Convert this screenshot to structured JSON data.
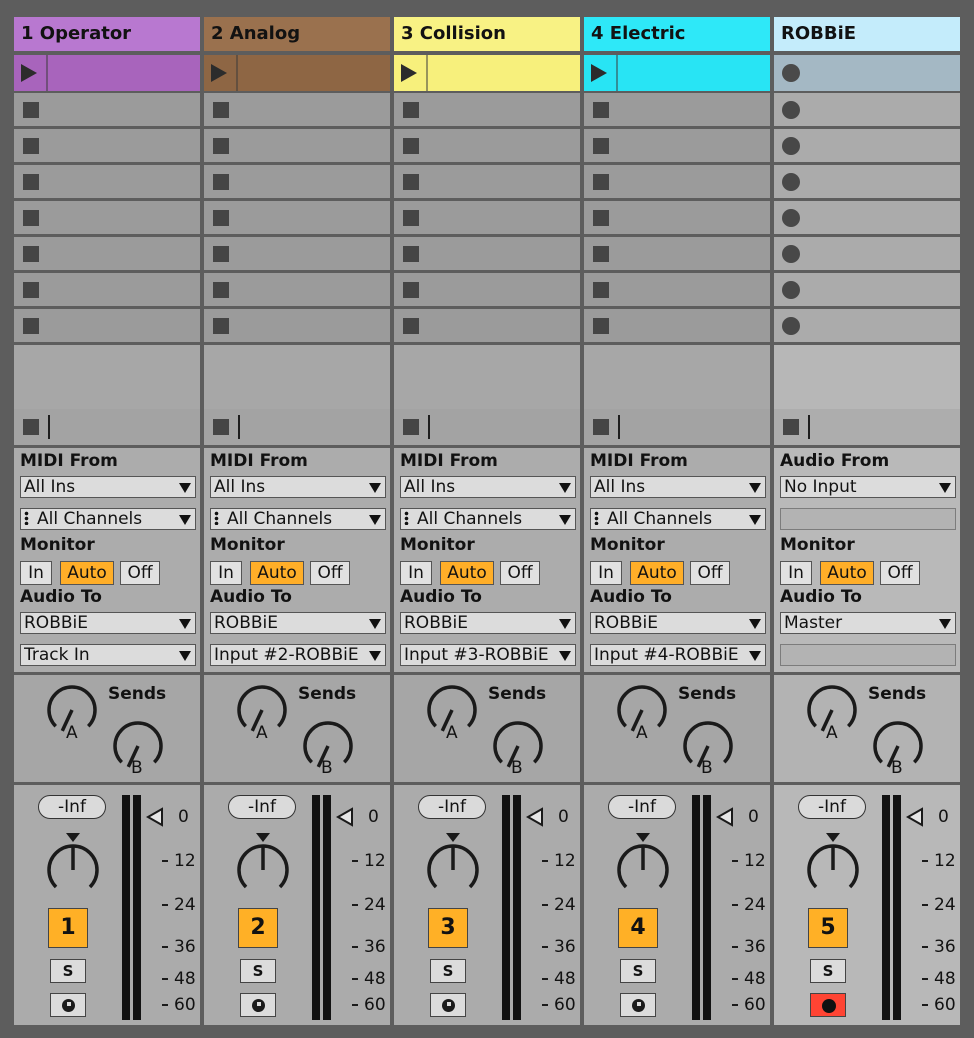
{
  "tracks": [
    {
      "name": "1 Operator",
      "color": "#b878d0",
      "ctl_color": "#a864bc",
      "type": "midi",
      "input_label": "MIDI From",
      "input": "All Ins",
      "channel": "All Channels",
      "monitor_label": "Monitor",
      "monitor": [
        "In",
        "Auto",
        "Off"
      ],
      "monitor_active": "Auto",
      "output_label": "Audio To",
      "output": "ROBBiE",
      "output_sub": "Track In",
      "sends_label": "Sends",
      "send_a": "A",
      "send_b": "B",
      "volume": "-Inf",
      "number": "1",
      "solo": "S",
      "button3": "monitor-input"
    },
    {
      "name": "2 Analog",
      "color": "#9a714e",
      "ctl_color": "#8e6644",
      "type": "midi",
      "input_label": "MIDI From",
      "input": "All Ins",
      "channel": "All Channels",
      "monitor_label": "Monitor",
      "monitor": [
        "In",
        "Auto",
        "Off"
      ],
      "monitor_active": "Auto",
      "output_label": "Audio To",
      "output": "ROBBiE",
      "output_sub": "Input #2-ROBBiE",
      "sends_label": "Sends",
      "send_a": "A",
      "send_b": "B",
      "volume": "-Inf",
      "number": "2",
      "solo": "S",
      "button3": "monitor-input"
    },
    {
      "name": "3 Collision",
      "color": "#f8f284",
      "ctl_color": "#f7f07c",
      "type": "midi",
      "input_label": "MIDI From",
      "input": "All Ins",
      "channel": "All Channels",
      "monitor_label": "Monitor",
      "monitor": [
        "In",
        "Auto",
        "Off"
      ],
      "monitor_active": "Auto",
      "output_label": "Audio To",
      "output": "ROBBiE",
      "output_sub": "Input #3-ROBBiE",
      "sends_label": "Sends",
      "send_a": "A",
      "send_b": "B",
      "volume": "-Inf",
      "number": "3",
      "solo": "S",
      "button3": "monitor-input"
    },
    {
      "name": "4 Electric",
      "color": "#2ee8f8",
      "ctl_color": "#28e4f4",
      "type": "midi",
      "input_label": "MIDI From",
      "input": "All Ins",
      "channel": "All Channels",
      "monitor_label": "Monitor",
      "monitor": [
        "In",
        "Auto",
        "Off"
      ],
      "monitor_active": "Auto",
      "output_label": "Audio To",
      "output": "ROBBiE",
      "output_sub": "Input #4-ROBBiE",
      "sends_label": "Sends",
      "send_a": "A",
      "send_b": "B",
      "volume": "-Inf",
      "number": "4",
      "solo": "S",
      "button3": "monitor-input"
    },
    {
      "name": "ROBBiE",
      "color": "#c4ecfb",
      "ctl_color": "#a4b8c4",
      "type": "audio",
      "input_label": "Audio From",
      "input": "No Input",
      "channel": "",
      "monitor_label": "Monitor",
      "monitor": [
        "In",
        "Auto",
        "Off"
      ],
      "monitor_active": "Auto",
      "output_label": "Audio To",
      "output": "Master",
      "output_sub": "",
      "sends_label": "Sends",
      "send_a": "A",
      "send_b": "B",
      "volume": "-Inf",
      "number": "5",
      "solo": "S",
      "button3": "arm-record"
    }
  ],
  "meter_scale": [
    "0",
    "12",
    "24",
    "36",
    "48",
    "60"
  ],
  "colors": {
    "monitor_active": "#ffae28",
    "track_number": "#ffb026",
    "arm_active": "#ff4433"
  },
  "icons": {
    "clip_play": "play-triangle-icon",
    "clip_stop": "stop-square-icon",
    "clip_record": "record-circle-icon",
    "knob": "knob-icon",
    "meter_peak": "peak-triangle-icon"
  }
}
